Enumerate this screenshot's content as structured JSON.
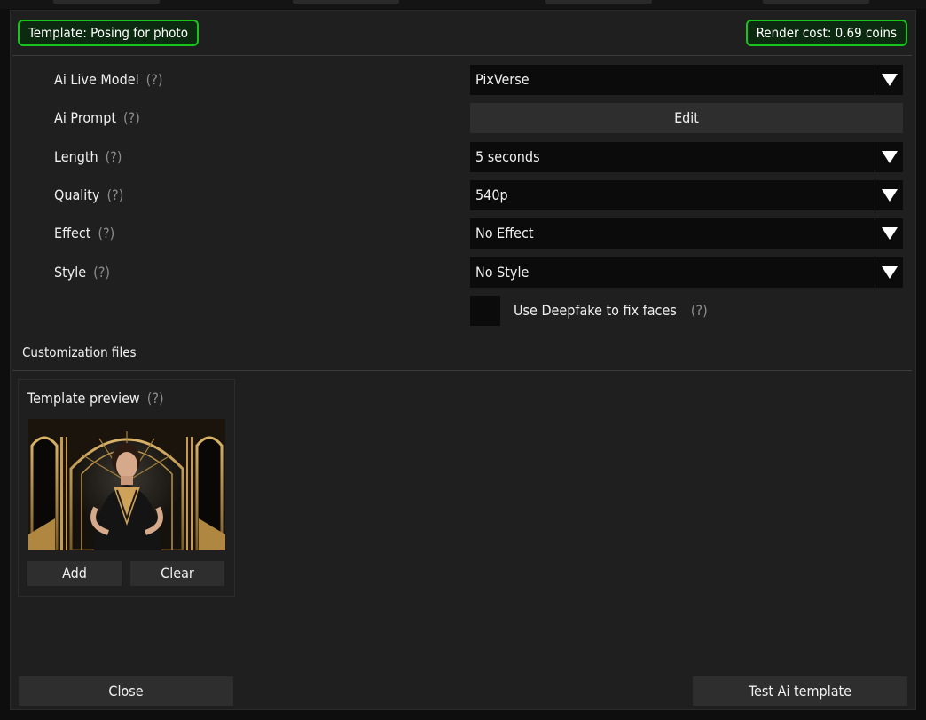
{
  "header": {
    "template_badge": "Template: Posing for photo",
    "render_cost_badge": "Render cost: 0.69 coins"
  },
  "settings": {
    "help_text": "(?)",
    "rows": [
      {
        "label": "Ai Live Model",
        "value": "PixVerse"
      },
      {
        "label": "Ai Prompt",
        "button": "Edit"
      },
      {
        "label": "Length",
        "value": "5 seconds"
      },
      {
        "label": "Quality",
        "value": "540p"
      },
      {
        "label": "Effect",
        "value": "No Effect"
      },
      {
        "label": "Style",
        "value": "No Style"
      }
    ],
    "deepfake_checkbox": {
      "label": "Use Deepfake to fix faces",
      "checked": false
    }
  },
  "customization": {
    "section_title": "Customization files",
    "template_preview": {
      "title": "Template preview",
      "add_label": "Add",
      "clear_label": "Clear"
    }
  },
  "footer": {
    "close_label": "Close",
    "test_label": "Test Ai template"
  },
  "colors": {
    "accent_green": "#19c31d",
    "panel_bg": "#1f1f1f",
    "field_bg": "#0b0b0b",
    "button_bg": "#2e2e2e"
  },
  "icons": {
    "dropdown": "triangle-down-icon"
  }
}
